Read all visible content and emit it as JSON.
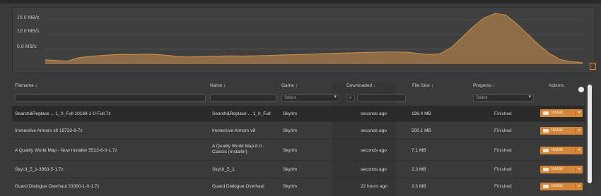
{
  "graph": {
    "y_ticks": [
      "15.0 MB/s",
      "10.0 MB/s",
      "5.0 MB/s"
    ],
    "speed_profile_mbps": [
      1.5,
      1.2,
      1.0,
      2.1,
      2.6,
      2.9,
      3.1,
      3.3,
      3.2,
      3.4,
      3.3,
      3.0,
      2.6,
      2.4,
      2.5,
      2.6,
      2.7,
      2.8,
      2.7,
      2.8,
      2.9,
      3.0,
      3.1,
      3.2,
      3.3,
      3.5,
      3.6,
      3.7,
      3.8,
      3.9,
      4.0,
      4.1,
      4.1,
      4.0,
      3.6,
      3.2,
      3.5,
      5.5,
      9.0,
      12.5,
      15.5,
      17.0,
      16.5,
      13.5,
      10.0,
      6.5,
      3.5,
      1.5,
      0.8,
      0.5
    ],
    "fill_color": "#9b7449",
    "line_color": "#c28a4c"
  },
  "table": {
    "headers": {
      "filename": "Filename ↕",
      "name": "Name ↕",
      "game": "Game ↕",
      "downloaded": "Downloaded ↓",
      "file_size": "File Size ↕",
      "progress": "Progress ↕",
      "actions": "Actions"
    },
    "filters": {
      "filename": "",
      "name": "",
      "game": "Select",
      "downloaded": "≥",
      "downloaded_value": "",
      "progress": "Select"
    },
    "rows": [
      {
        "filename": "Search&Replace ... 1_0_Full 10168-1-0-Full.7z",
        "name": "Search&Replace ... 1_0_Full",
        "game": "Skyrim",
        "downloaded": "seconds ago",
        "file_size": "199.4 MB",
        "progress": "Finished",
        "action": "Install"
      },
      {
        "filename": "Immersive Armors v8 19733-8-7z",
        "name": "Immersive Armors v8",
        "game": "Skyrim",
        "downloaded": "seconds ago",
        "file_size": "500.1 MB",
        "progress": "Finished",
        "action": "Install"
      },
      {
        "filename": "A Quality World Map - Now Installer 5523-8-0-1.7z",
        "name": "A Quality World Map 8.0 - Classic (Installer)",
        "game": "Skyrim",
        "downloaded": "seconds ago",
        "file_size": "7.1 MB",
        "progress": "Finished",
        "action": "Install"
      },
      {
        "filename": "SkyUI_5_1-3863-5-1.7z",
        "name": "SkyUI_5_1",
        "game": "Skyrim",
        "downloaded": "seconds ago",
        "file_size": "2.3 MB",
        "progress": "Finished",
        "action": "Install"
      },
      {
        "filename": "Guard Dialogue Overhaul 23390-1-0-1.7z",
        "name": "Guard Dialogue Overhaul",
        "game": "Skyrim",
        "downloaded": "22 hours ago",
        "file_size": "2.3 MB",
        "progress": "Finished",
        "action": "Install"
      }
    ]
  },
  "colors": {
    "accent": "#d4873a",
    "background": "#3a3a3a",
    "selected_row": "#2a2a2a"
  }
}
